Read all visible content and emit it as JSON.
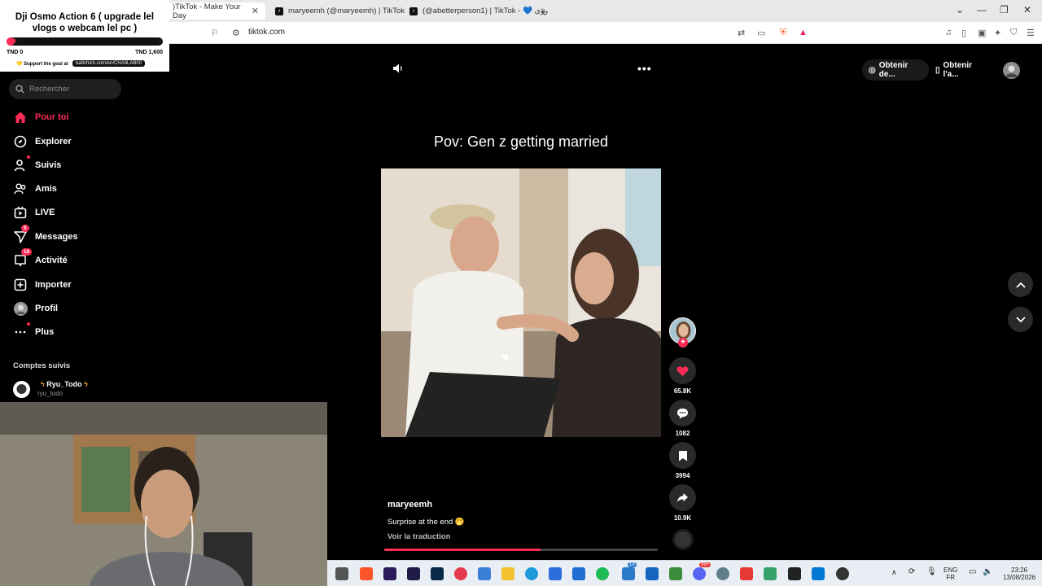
{
  "browser": {
    "tabs": [
      {
        "label": ")TikTok - Make Your Day",
        "active": true
      },
      {
        "label": "maryeemh (@maryeemh) | TikTok",
        "active": false
      },
      {
        "label": "(@abetterperson1) | TikTok - 💙 رؤى",
        "active": false
      }
    ],
    "new_tab_symbol": "+",
    "url": "tiktok.com"
  },
  "goal_overlay": {
    "title": "Dji Osmo Action 6 ( upgrade lel vlogs o webcam lel pc )",
    "bar_label": "0%",
    "progress_fraction": 0.0,
    "min_label": "TND 0",
    "max_label": "TND 1,600",
    "support_text": "💛 Support the goal at",
    "support_link": "ba9chich.com/en/CHA9LAB00"
  },
  "sidebar": {
    "search_placeholder": "Rechercher",
    "items": [
      {
        "label": "Pour toi",
        "icon": "home-icon"
      },
      {
        "label": "Explorer",
        "icon": "compass-icon"
      },
      {
        "label": "Suivis",
        "icon": "following-icon"
      },
      {
        "label": "Amis",
        "icon": "friends-icon"
      },
      {
        "label": "LIVE",
        "icon": "live-icon"
      },
      {
        "label": "Messages",
        "icon": "messages-icon",
        "badge": "5"
      },
      {
        "label": "Activité",
        "icon": "activity-icon",
        "badge": "16"
      },
      {
        "label": "Importer",
        "icon": "upload-icon"
      },
      {
        "label": "Profil",
        "icon": "profile-avatar"
      },
      {
        "label": "Plus",
        "icon": "more-icon"
      }
    ],
    "followed_heading": "Comptes suivis",
    "followed_account": {
      "name": "Ryu_Todo",
      "handle": "ryu_todo"
    }
  },
  "header": {
    "get_desktop": "Obtenir de...",
    "get_app": "Obtenir l'a..."
  },
  "video": {
    "title": "Pov: Gen z getting married",
    "author": "maryeemh",
    "description": "Surprise at the end 🤭",
    "translate_label": "Voir la traduction",
    "progress_fraction": 0.57,
    "likes": "65.8K",
    "comments": "1082",
    "saves": "3994",
    "shares": "10.9K"
  },
  "taskbar": {
    "lang_top": "ENG",
    "lang_bottom": "FR",
    "time": "23:26",
    "date": "13/08/2026",
    "badges": {
      "app_a": "19",
      "app_b": "99+"
    }
  },
  "colors": {
    "accent": "#fe2c55",
    "background": "#000000"
  }
}
